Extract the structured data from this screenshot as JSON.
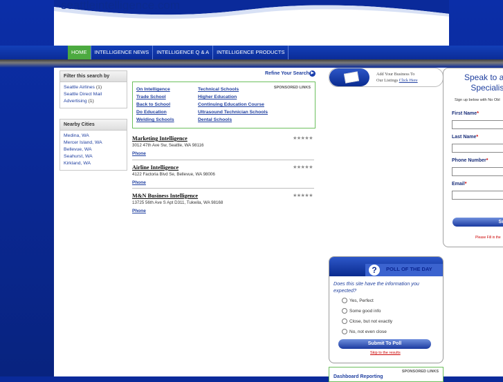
{
  "site": {
    "title": "seattleintelligence.com"
  },
  "nav": {
    "items": [
      {
        "label": "HOME",
        "active": true
      },
      {
        "label": "INTELLIGENCE NEWS",
        "active": false
      },
      {
        "label": "INTELLIGENCE Q & A",
        "active": false
      },
      {
        "label": "INTELLIGENCE PRODUCTS",
        "active": false
      }
    ]
  },
  "filter": {
    "title": "Filter this search by",
    "items": [
      {
        "label": "Seattle Airlines",
        "count": "(1)"
      },
      {
        "label": "Seattle Direct Mail Advertising",
        "count": "(1)"
      }
    ]
  },
  "nearby": {
    "title": "Nearby Cities",
    "items": [
      "Medina, WA",
      "Mercer Island, WA",
      "Bellevue, WA",
      "Seahurst, WA",
      "Kirkland, WA"
    ]
  },
  "refine": {
    "label": "Refine Your Search"
  },
  "sponsored": {
    "tag": "SPONSORED LINKS",
    "col1": [
      "On Intelligence",
      "Trade School",
      "Back to School",
      "Do Education",
      "Welding Schools"
    ],
    "col2": [
      "Technical Schools",
      "Higher Education",
      "Continuing Education Course",
      "Ultrasound Technician Schools",
      "Dental Schools"
    ]
  },
  "listings": [
    {
      "name": "Marketing Intelligence",
      "address": "3012 47th Ave Sw, Seattle, WA 98116",
      "phone": "Phone",
      "stars": "★★★★★"
    },
    {
      "name": "Airline Intelligence",
      "address": "4122 Factoria Blvd Se, Bellevue, WA 98006",
      "phone": "Phone",
      "stars": "★★★★★"
    },
    {
      "name": "M&N Business Intelligence",
      "address": "13725 56th Ave S Apt D311, Tukwila, WA 98168",
      "phone": "Phone",
      "stars": "★★★★★"
    }
  ],
  "add_business": {
    "line1": "Add Your Business To",
    "line2": "Our Listings",
    "link": "Click Here"
  },
  "lead_form": {
    "title": "Speak to a Li Specialist",
    "subtitle": "Sign up below with No Obl",
    "fields": [
      {
        "label": "First Name",
        "req": "*"
      },
      {
        "label": "Last Name",
        "req": "*"
      },
      {
        "label": "Phone Number",
        "req": "*"
      },
      {
        "label": "Email",
        "req": "*"
      }
    ],
    "submit": "Subm",
    "fill_note": "Please Fill in the"
  },
  "poll": {
    "title": "POLL OF THE DAY",
    "question": "Does this site have the information you expected?",
    "options": [
      "Yes, Perfect",
      "Some good info",
      "Close, but not exactly",
      "No, not even close"
    ],
    "submit": "Submit To Poll",
    "skip": "Skip to the results"
  },
  "sponsored2": {
    "tag": "SPONSORED LINKS",
    "link": "Dashboard Reporting"
  }
}
